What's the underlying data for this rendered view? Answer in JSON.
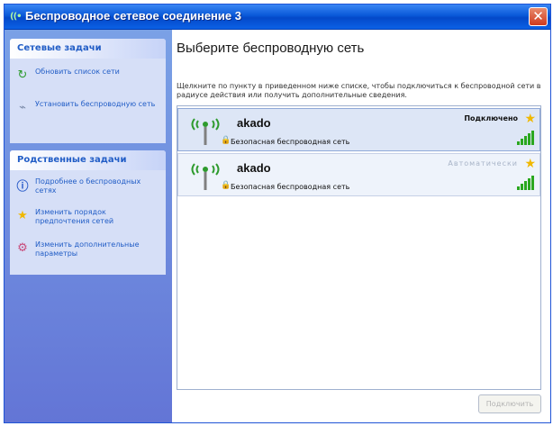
{
  "window": {
    "title": "Беспроводное сетевое соединение 3",
    "title_icon": "wireless-icon",
    "close": "✕"
  },
  "sidebar": {
    "network_tasks": {
      "header": "Сетевые задачи",
      "items": [
        {
          "label": "Обновить список сети",
          "icon": "refresh-icon"
        },
        {
          "label": "Установить беспроводную сеть",
          "icon": "setup-wireless-icon"
        }
      ]
    },
    "related_tasks": {
      "header": "Родственные задачи",
      "items": [
        {
          "label": "Подробнее о беспроводных сетях",
          "icon": "info-icon"
        },
        {
          "label": "Изменить порядок предпочтения сетей",
          "icon": "star-icon"
        },
        {
          "label": "Изменить дополнительные параметры",
          "icon": "settings-icon"
        }
      ]
    }
  },
  "main": {
    "heading": "Выберите беспроводную сеть",
    "description": "Щелкните по пункту в приведенном ниже списке, чтобы подключиться к беспроводной сети в радиусе действия или получить дополнительные сведения.",
    "networks": [
      {
        "name": "akado",
        "status": "Подключено",
        "security": "Безопасная беспроводная сеть",
        "signal_bars": 5,
        "selected": true
      },
      {
        "name": "akado",
        "status": "Автоматически",
        "security": "Безопасная беспроводная сеть",
        "signal_bars": 5,
        "selected": false
      }
    ],
    "connect_button": "Подключить"
  },
  "colors": {
    "titlebar": "#0a59d9",
    "sidebar": "#6f8ee0",
    "link": "#215dc6",
    "signal": "#2aa71f",
    "star": "#f0b800"
  }
}
